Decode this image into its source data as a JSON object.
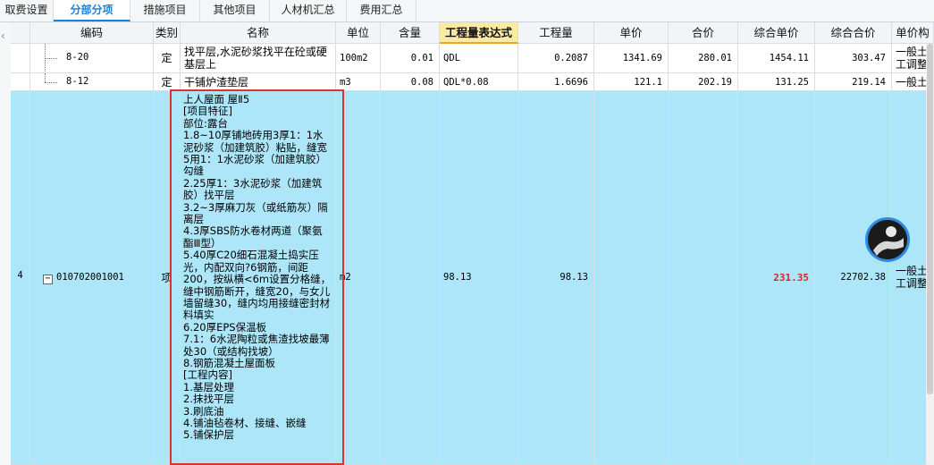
{
  "tabs": [
    {
      "label": "取费设置",
      "active": false
    },
    {
      "label": "分部分项",
      "active": true
    },
    {
      "label": "措施项目",
      "active": false
    },
    {
      "label": "其他项目",
      "active": false
    },
    {
      "label": "人材机汇总",
      "active": false
    },
    {
      "label": "费用汇总",
      "active": false
    }
  ],
  "columns": {
    "code": "编码",
    "category": "类别",
    "name": "名称",
    "unit": "单位",
    "content": "含量",
    "expression": "工程量表达式",
    "quantity": "工程量",
    "unit_price": "单价",
    "total_price": "合价",
    "composite_unit_price": "综合单价",
    "composite_total": "综合合价",
    "unit_price_truncated": "单价构"
  },
  "sub_rows": [
    {
      "code": "8-20",
      "category": "定",
      "name_line1": "找平层,水泥砂浆找平在砼或硬",
      "name_line2": "基层上",
      "unit": "100m2",
      "content": "0.01",
      "expression": "QDL",
      "quantity": "0.2087",
      "unit_price": "1341.69",
      "total_price": "280.01",
      "composite_unit_price": "1454.11",
      "composite_total": "303.47",
      "unit_price_cut_line1": "一般土",
      "unit_price_cut_line2": "工调整"
    },
    {
      "code": "8-12",
      "category": "定",
      "name_line1": "干铺炉渣垫层",
      "unit": "m3",
      "content": "0.08",
      "expression": "QDL*0.08",
      "quantity": "1.6696",
      "unit_price": "121.1",
      "total_price": "202.19",
      "composite_unit_price": "131.25",
      "composite_total": "219.14",
      "unit_price_cut_line1": "一般土"
    }
  ],
  "main_row": {
    "index": "4",
    "expander": "−",
    "code": "010702001001",
    "category": "项",
    "unit": "m2",
    "expression": "98.13",
    "quantity": "98.13",
    "composite_unit_price": "231.35",
    "composite_total": "22702.38",
    "unit_price_cut_line1": "一般土",
    "unit_price_cut_line2": "工调整",
    "description": [
      "上人屋面  屋Ⅱ5",
      "[项目特征]",
      "部位:露台",
      "1.8~10厚铺地砖用3厚1：1水泥砂浆（加建筑胶）粘贴，缝宽5用1：1水泥砂浆（加建筑胶）勾缝",
      "2.25厚1：3水泥砂浆（加建筑胶）找平层",
      "3.2~3厚麻刀灰（或纸筋灰）隔离层",
      "4.3厚SBS防水卷材两道（聚氨酯Ⅲ型）",
      "5.40厚C20细石混凝土捣实压光，内配双向?6钢筋，间距200，按纵横<6m设置分格缝，缝中钢筋断开，缝宽20，与女儿墙留缝30，缝内均用接缝密封材料填实",
      "6.20厚EPS保温板",
      "7.1：6水泥陶粒或焦渣找坡最薄处30（或结构找坡）",
      "8.钢筋混凝土屋面板",
      "[工程内容]",
      "1.基层处理",
      "2.抹找平层",
      "3.刷底油",
      "4.铺油毡卷材、接缝、嵌缝",
      "5.铺保护层"
    ]
  },
  "colors": {
    "highlight_row": "#ade6f8",
    "active_tab": "#1f7fd6",
    "highlight_header": "#fbeaa6",
    "red_value": "#e02020",
    "annotation_box": "#e03131"
  },
  "icons": {
    "collapse_left": "chevron-left-icon",
    "tree_collapse": "minus-box-icon",
    "avatar": "user-avatar-icon"
  }
}
